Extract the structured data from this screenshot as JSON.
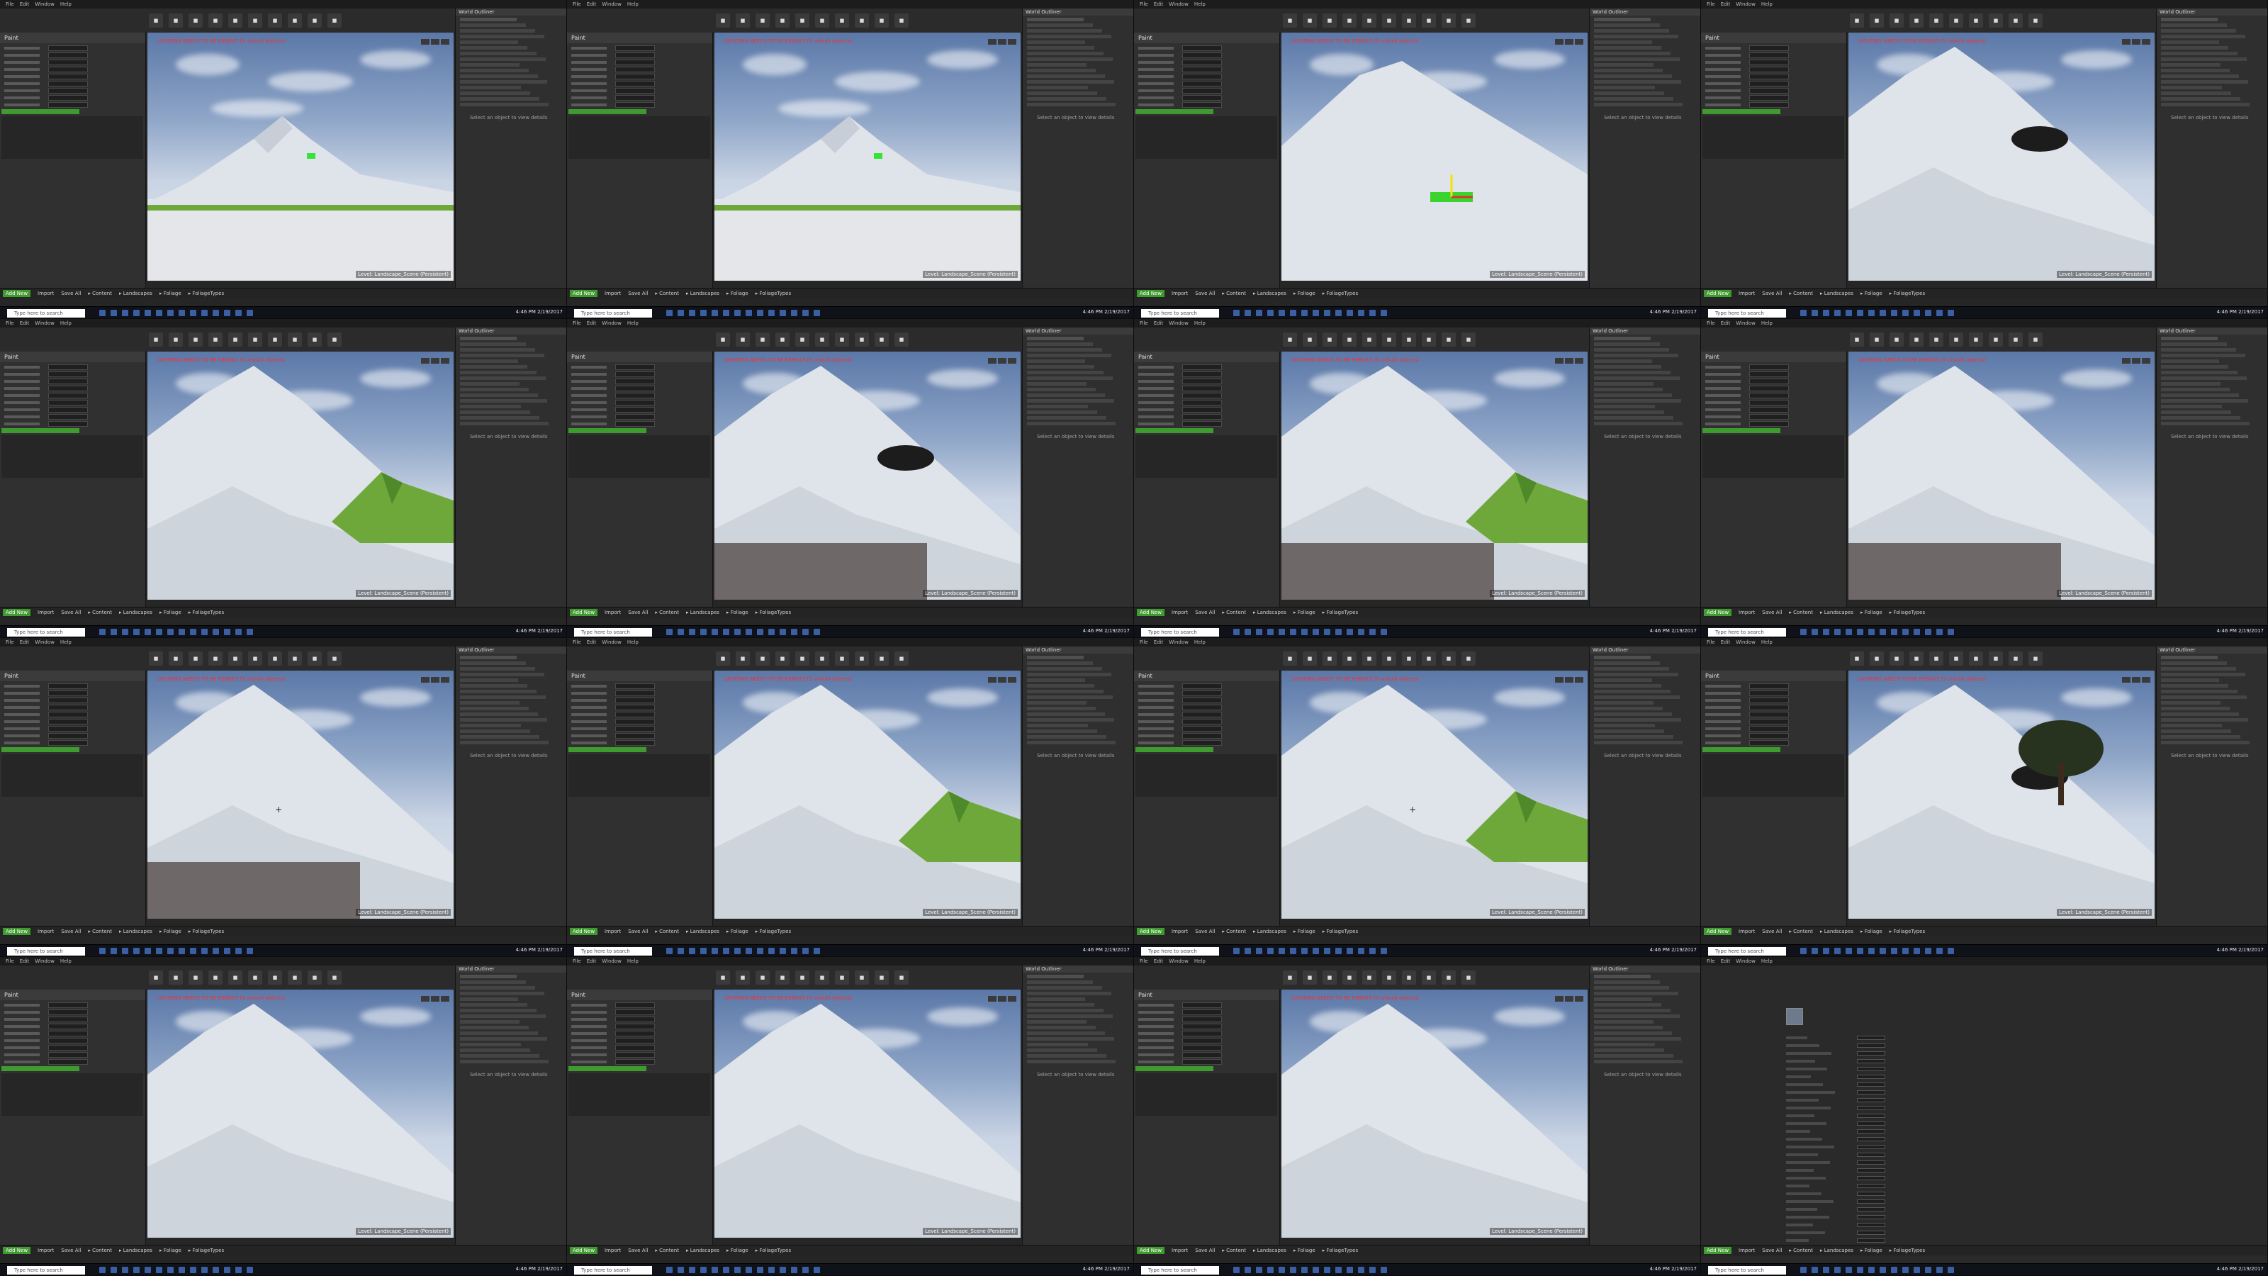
{
  "app": {
    "menu": [
      "File",
      "Edit",
      "Window",
      "Help"
    ],
    "toolbar_icons": [
      "save-icon",
      "source-icon",
      "content-icon",
      "marketplace-icon",
      "settings-icon",
      "blueprints-icon",
      "cinematics-icon",
      "build-icon",
      "play-icon",
      "launch-icon"
    ],
    "mode_title": "Paint",
    "viewport_warning": "LIGHTING NEEDS TO BE REBUILT (5 unbuilt objects)",
    "viewport_level_label": "Level: Landscape_Scene (Persistent)",
    "viewport_modes": [
      "Perspective",
      "Lit",
      "Show"
    ],
    "outliner_hint": "Select an object to view details",
    "content_bar": {
      "add_new": "Add New",
      "import": "Import",
      "save_all": "Save All",
      "path": [
        "Content",
        "Landscapes",
        "Foliage",
        "FoliageTypes"
      ]
    },
    "taskbar": {
      "search_placeholder": "Type here to search",
      "time": "4:46 PM",
      "date": "2/19/2017"
    }
  },
  "frames": [
    {
      "id": 1,
      "scene": "mountain-distant",
      "note": ""
    },
    {
      "id": 2,
      "scene": "mountain-distant",
      "note": ""
    },
    {
      "id": 3,
      "scene": "mountain-closeup-gizmo",
      "note": ""
    },
    {
      "id": 4,
      "scene": "slope-trees",
      "note": ""
    },
    {
      "id": 5,
      "scene": "slope-green-hill",
      "note": ""
    },
    {
      "id": 6,
      "scene": "slope-foliage-tree",
      "note": ""
    },
    {
      "id": 7,
      "scene": "plain-foliage-hill",
      "note": ""
    },
    {
      "id": 8,
      "scene": "mountain-foliage",
      "note": ""
    },
    {
      "id": 9,
      "scene": "mountain-foliage-cursor",
      "note": ""
    },
    {
      "id": 10,
      "scene": "slope-green-hill",
      "note": ""
    },
    {
      "id": 11,
      "scene": "slope-green-hill-cursor",
      "note": ""
    },
    {
      "id": 12,
      "scene": "slope-big-tree",
      "note": ""
    },
    {
      "id": 13,
      "scene": "slope-snow",
      "note": ""
    },
    {
      "id": 14,
      "scene": "slope-snow-sky",
      "note": ""
    },
    {
      "id": 15,
      "scene": "slope-snow-left",
      "note": ""
    },
    {
      "id": 16,
      "scene": "details-panel",
      "note": ""
    }
  ],
  "colors": {
    "accent_green": "#3f9b2f",
    "warning_red": "#ff2a2a",
    "panel_dark": "#2f2f2f"
  }
}
